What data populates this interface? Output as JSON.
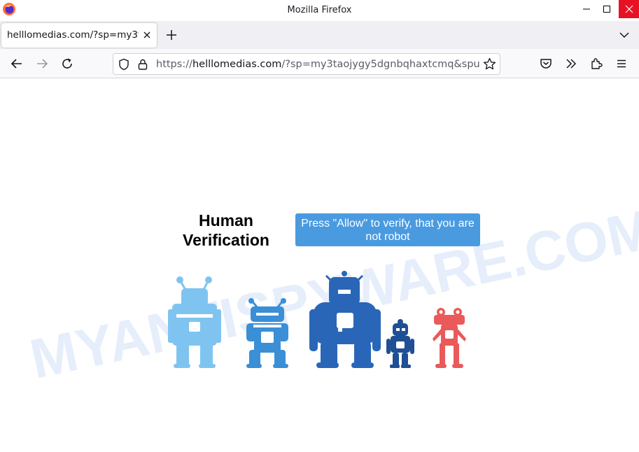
{
  "window": {
    "title": "Mozilla Firefox"
  },
  "tabs": [
    {
      "label": "helllomedias.com/?sp=my3t"
    }
  ],
  "urlbar": {
    "scheme": "https://",
    "host": "helllomedias.com",
    "path": "/?sp=my3taojygy5dgnbqhaxtcmq&spu="
  },
  "page": {
    "heading": "Human Verification",
    "notice": "Press \"Allow\" to verify, that you are not robot",
    "watermark": "MYANTISPYWARE.COM"
  },
  "colors": {
    "notice_bg": "#4a9ae0",
    "robot_light_blue": "#7fc4f0",
    "robot_mid_blue": "#3a8fd6",
    "robot_dark_blue": "#2a66b8",
    "robot_navy": "#1f4f94",
    "robot_red": "#ea5a5a",
    "close_button": "#e81123"
  }
}
